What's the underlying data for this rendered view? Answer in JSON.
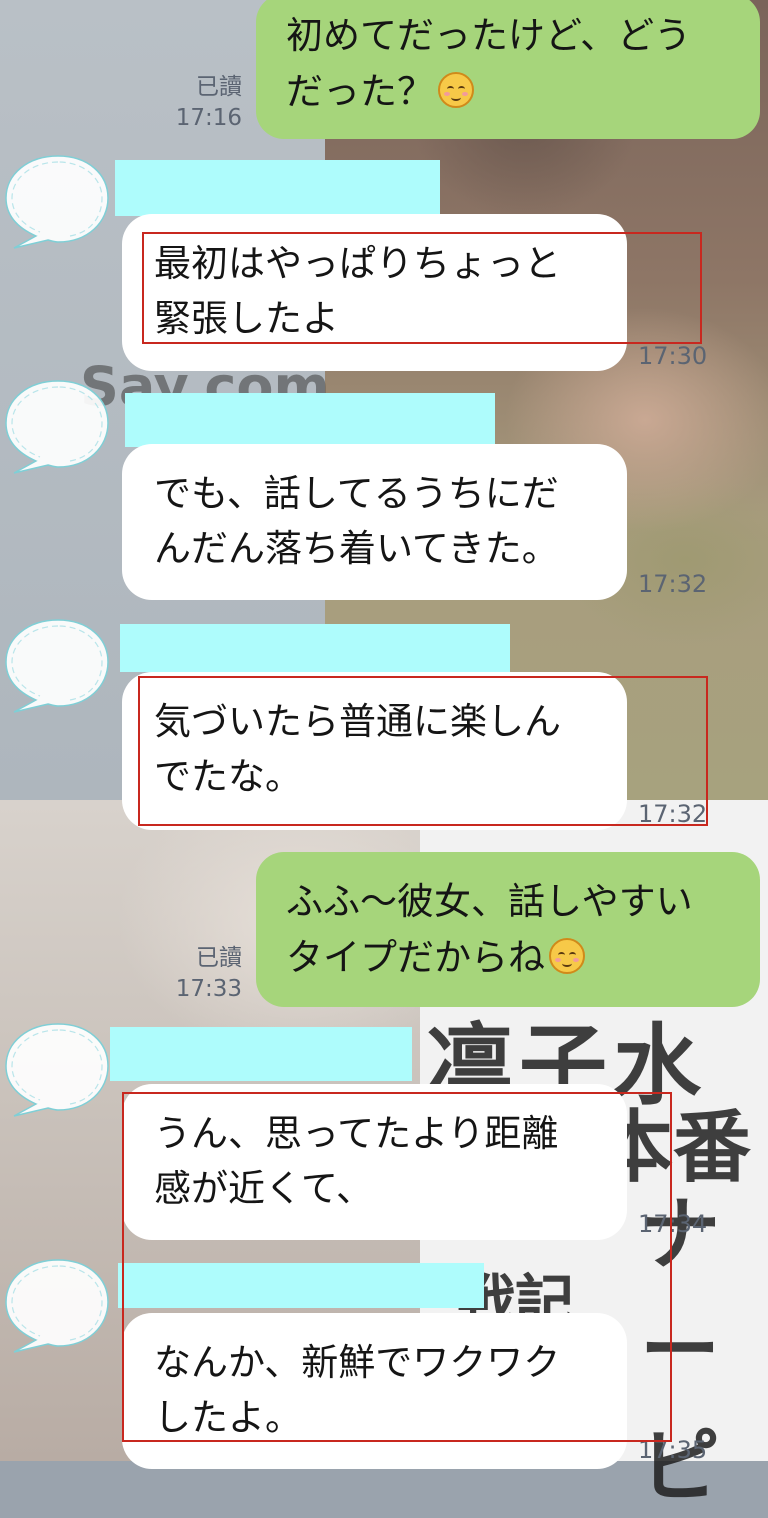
{
  "colors": {
    "outgoing_bubble": "#a6d57b",
    "incoming_bubble": "#ffffff",
    "name_redaction": "#aefcfc",
    "highlight_box": "#c8281f",
    "meta_text": "#5b6472"
  },
  "watermark": {
    "site_fragment": "Say.com",
    "store_name": [
      "凛子水月閣",
      "本番",
      "ナーピ",
      "戦記"
    ]
  },
  "messages": [
    {
      "direction": "out",
      "lines": [
        "初めてだったけど、どう",
        "だった？"
      ],
      "emoji": "relieved-face-emoji",
      "read_label": "已讀",
      "time": "17:16"
    },
    {
      "direction": "in",
      "lines": [
        "最初はやっぱりちょっと",
        "緊張したよ"
      ],
      "time": "17:30",
      "highlighted": true
    },
    {
      "direction": "in",
      "lines": [
        "でも、話してるうちにだ",
        "んだん落ち着いてきた。"
      ],
      "time": "17:32",
      "highlighted": false
    },
    {
      "direction": "in",
      "lines": [
        "気づいたら普通に楽しん",
        "でたな。"
      ],
      "time": "17:32",
      "highlighted": true
    },
    {
      "direction": "out",
      "lines": [
        "ふふ〜彼女、話しやすい",
        "タイプだからね"
      ],
      "emoji": "smiling-face-emoji",
      "read_label": "已讀",
      "time": "17:33"
    },
    {
      "direction": "in",
      "lines": [
        "うん、思ってたより距離",
        "感が近くて、"
      ],
      "time": "17:34",
      "highlighted": true
    },
    {
      "direction": "in",
      "lines": [
        "なんか、新鮮でワクワク",
        "したよ。"
      ],
      "time": "17:35",
      "highlighted": true
    }
  ]
}
